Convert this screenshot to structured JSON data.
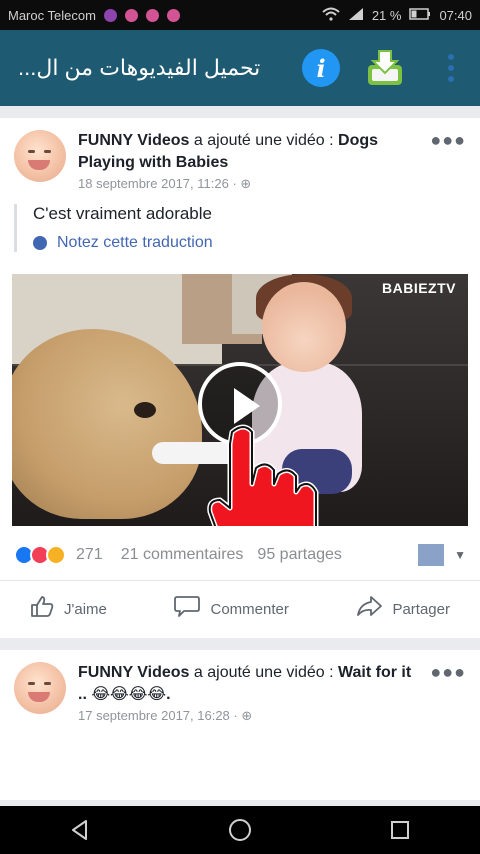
{
  "status_bar": {
    "carrier": "Maroc Telecom",
    "battery": "21 %",
    "time": "07:40",
    "app_dot_colors": [
      "#8e44ad",
      "#d35494",
      "#d35494",
      "#d35494"
    ]
  },
  "app_bar": {
    "title": "تحميل الفيديوهات من ال...",
    "icons": [
      "info-icon",
      "download-icon",
      "more-vertical-icon"
    ]
  },
  "posts": [
    {
      "page": "FUNNY Videos",
      "action": "a ajouté une vidéo :",
      "video_title": "Dogs Playing with Babies",
      "time": "18 septembre 2017, 11:26",
      "text": "C'est vraiment adorable",
      "translate": "Notez cette traduction",
      "watermark": "BABIEZTV",
      "reactions": "271",
      "comments": "21 commentaires",
      "shares": "95 partages",
      "like": "J'aime",
      "comment": "Commenter",
      "share": "Partager"
    },
    {
      "page": "FUNNY Videos",
      "action": "a ajouté une vidéo :",
      "video_title": "Wait for it .. 😂😂😂😂.",
      "time": "17 septembre 2017, 16:28"
    }
  ]
}
